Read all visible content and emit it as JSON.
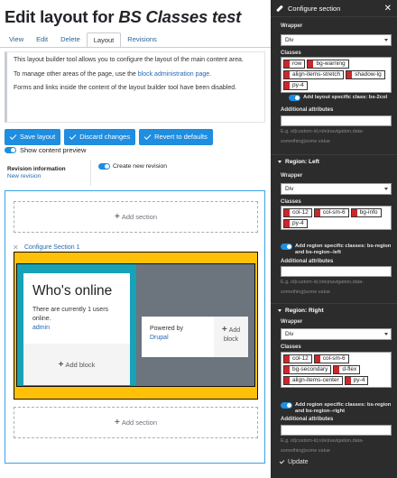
{
  "page": {
    "title_prefix": "Edit layout for ",
    "title_entity": "BS Classes test"
  },
  "tabs": [
    "View",
    "Edit",
    "Delete",
    "Layout",
    "Revisions"
  ],
  "active_tab": "Layout",
  "message": {
    "line1": "This layout builder tool allows you to configure the layout of the main content area.",
    "line2_before": "To manage other areas of the page, use the ",
    "line2_link": "block administration page",
    "line2_after": ".",
    "line3": "Forms and links inside the content of the layout builder tool have been disabled."
  },
  "actions": {
    "save": "Save layout",
    "discard": "Discard changes",
    "revert": "Revert to defaults"
  },
  "show_preview": {
    "label": "Show content preview",
    "checked": true
  },
  "revision": {
    "title": "Revision information",
    "subtitle": "New revision",
    "create_label": "Create new revision",
    "create_checked": true
  },
  "builder": {
    "add_section": "Add section",
    "close_glyph": "✕",
    "configure_section": "Configure Section 1",
    "online_title": "Who's online",
    "online_text": "There are currently 1 users online.",
    "online_user": "admin",
    "add_block": "Add block",
    "powered_by": "Powered by",
    "powered_link": "Drupal",
    "add_block_line1": "Add",
    "add_block_line2": "block"
  },
  "sidebar": {
    "title": "Configure section",
    "close_glyph": "✕",
    "wrapper": {
      "label": "Wrapper",
      "value": "Div",
      "classes_label": "Classes",
      "classes": [
        "row",
        "bg-warning",
        "align-items-stretch",
        "shadow-lg",
        "py-4"
      ],
      "specific_label": "Add layout specific class: bs-2col",
      "attrs_label": "Additional attributes",
      "attrs_hint_1": "E.g. id|custom-id,role|navigation,data-",
      "attrs_hint_2": "something|some value"
    },
    "left": {
      "head": "Region: Left",
      "wrapper_label": "Wrapper",
      "value": "Div",
      "classes_label": "Classes",
      "classes": [
        "col-12",
        "col-sm-6",
        "bg-info",
        "py-4"
      ],
      "specific_label": "Add region specific classes: bs-region and bs-region--left",
      "attrs_label": "Additional attributes",
      "attrs_hint_1": "E.g. id|custom-id,role|navigation,data-",
      "attrs_hint_2": "something|some value"
    },
    "right": {
      "head": "Region: Right",
      "wrapper_label": "Wrapper",
      "value": "Div",
      "classes_label": "Classes",
      "classes": [
        "col-12",
        "col-sm-6",
        "bg-secondary",
        "d-flex",
        "align-items-center",
        "py-4"
      ],
      "specific_label": "Add region specific classes: bs-region and bs-region--right",
      "attrs_label": "Additional attributes",
      "attrs_hint_1": "E.g. id|custom-id,role|navigation,data-",
      "attrs_hint_2": "something|some value"
    },
    "update": "Update"
  },
  "colors": {
    "primary_button": "#1f8de0",
    "link": "#2369b2",
    "bg_warning": "#ffc107",
    "bg_info": "#17a2b8",
    "bg_secondary": "#6c757d",
    "sidebar_bg": "#2c2c2c",
    "chip_remove": "#c9282d"
  },
  "icons": {
    "check": "check-icon",
    "plus": "plus-icon",
    "pencil": "pencil-icon",
    "close": "close-icon",
    "chevron": "chevron-down-icon"
  }
}
